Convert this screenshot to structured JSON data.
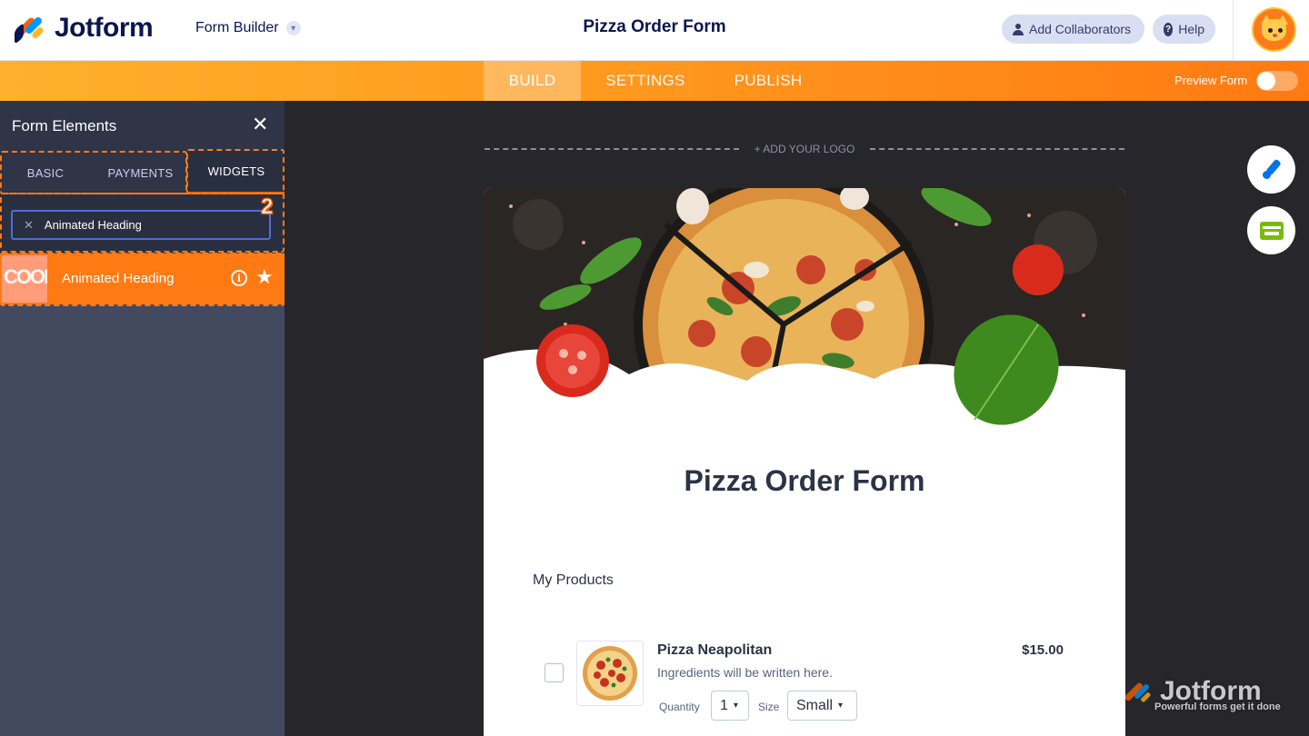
{
  "header": {
    "brand": "Jotform",
    "builder_label": "Form Builder",
    "form_title": "Pizza Order Form",
    "add_collaborators": "Add Collaborators",
    "help": "Help"
  },
  "nav": {
    "tabs": [
      "BUILD",
      "SETTINGS",
      "PUBLISH"
    ],
    "active_tab": "BUILD",
    "preview_label": "Preview Form",
    "preview_enabled": false
  },
  "panel": {
    "title": "Form Elements",
    "tabs": [
      "BASIC",
      "PAYMENTS",
      "WIDGETS"
    ],
    "active_tab": "WIDGETS",
    "search_value": "Animated Heading",
    "step_marker": "2",
    "results": [
      {
        "label": "Animated Heading",
        "thumb_text": "COOL"
      }
    ]
  },
  "canvas": {
    "add_logo": "+ ADD YOUR LOGO",
    "form_heading": "Pizza Order Form",
    "products_label": "My Products",
    "product": {
      "name": "Pizza Neapolitan",
      "description": "Ingredients will be written here.",
      "price": "$15.00",
      "quantity_label": "Quantity",
      "quantity_value": "1",
      "size_label": "Size",
      "size_value": "Small"
    }
  },
  "watermark": {
    "brand": "Jotform",
    "tagline": "Powerful forms get it done"
  },
  "colors": {
    "accent_orange": "#ff6100",
    "navy": "#0a1551",
    "panel_bg": "#434a60",
    "canvas_bg": "#27272b"
  }
}
